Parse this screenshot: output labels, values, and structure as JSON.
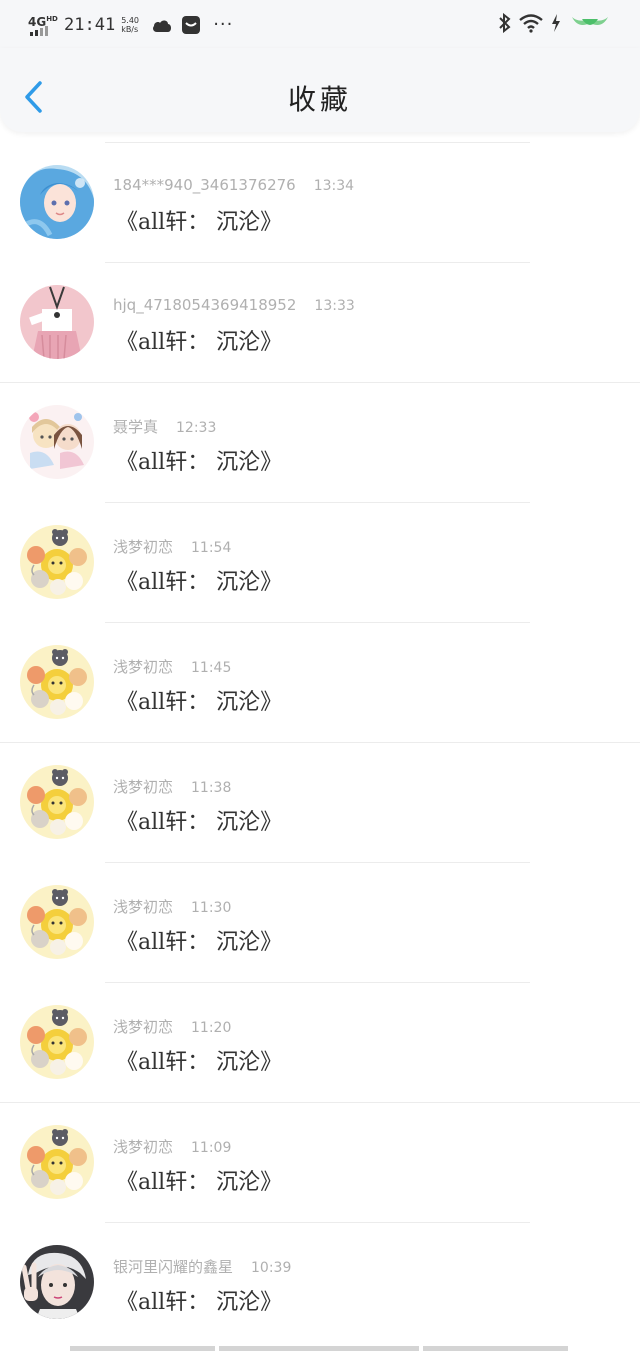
{
  "status_bar": {
    "network": "4G",
    "network_sup": "HD",
    "time": "21:41",
    "speed_value": "5.40",
    "speed_unit": "kB/s",
    "more": "···"
  },
  "header": {
    "title": "收藏"
  },
  "items": [
    {
      "user": "184***940_3461376276",
      "time": "13:34",
      "content": "《all轩：  沉沦》",
      "avatar": "blue-hair-girl"
    },
    {
      "user": "hjq_4718054369418952",
      "time": "13:33",
      "content": "《all轩：  沉沦》",
      "avatar": "pink-uniform-girl"
    },
    {
      "user": "聂学真",
      "time": "12:33",
      "content": "《all轩：  沉沦》",
      "avatar": "two-dolls"
    },
    {
      "user": "浅梦初恋",
      "time": "11:54",
      "content": "《all轩：  沉沦》",
      "avatar": "cartoon-cluster"
    },
    {
      "user": "浅梦初恋",
      "time": "11:45",
      "content": "《all轩：  沉沦》",
      "avatar": "cartoon-cluster"
    },
    {
      "user": "浅梦初恋",
      "time": "11:38",
      "content": "《all轩：  沉沦》",
      "avatar": "cartoon-cluster"
    },
    {
      "user": "浅梦初恋",
      "time": "11:30",
      "content": "《all轩：  沉沦》",
      "avatar": "cartoon-cluster"
    },
    {
      "user": "浅梦初恋",
      "time": "11:20",
      "content": "《all轩：  沉沦》",
      "avatar": "cartoon-cluster"
    },
    {
      "user": "浅梦初恋",
      "time": "11:09",
      "content": "《all轩：  沉沦》",
      "avatar": "cartoon-cluster"
    },
    {
      "user": "银河里闪耀的鑫星",
      "time": "10:39",
      "content": "《all轩：  沉沦》",
      "avatar": "boy-peace-sign"
    }
  ],
  "colors": {
    "accent": "#2f9be8",
    "meta": "#b0b0b0",
    "text": "#333333",
    "header_bg": "#f6f7f9"
  }
}
